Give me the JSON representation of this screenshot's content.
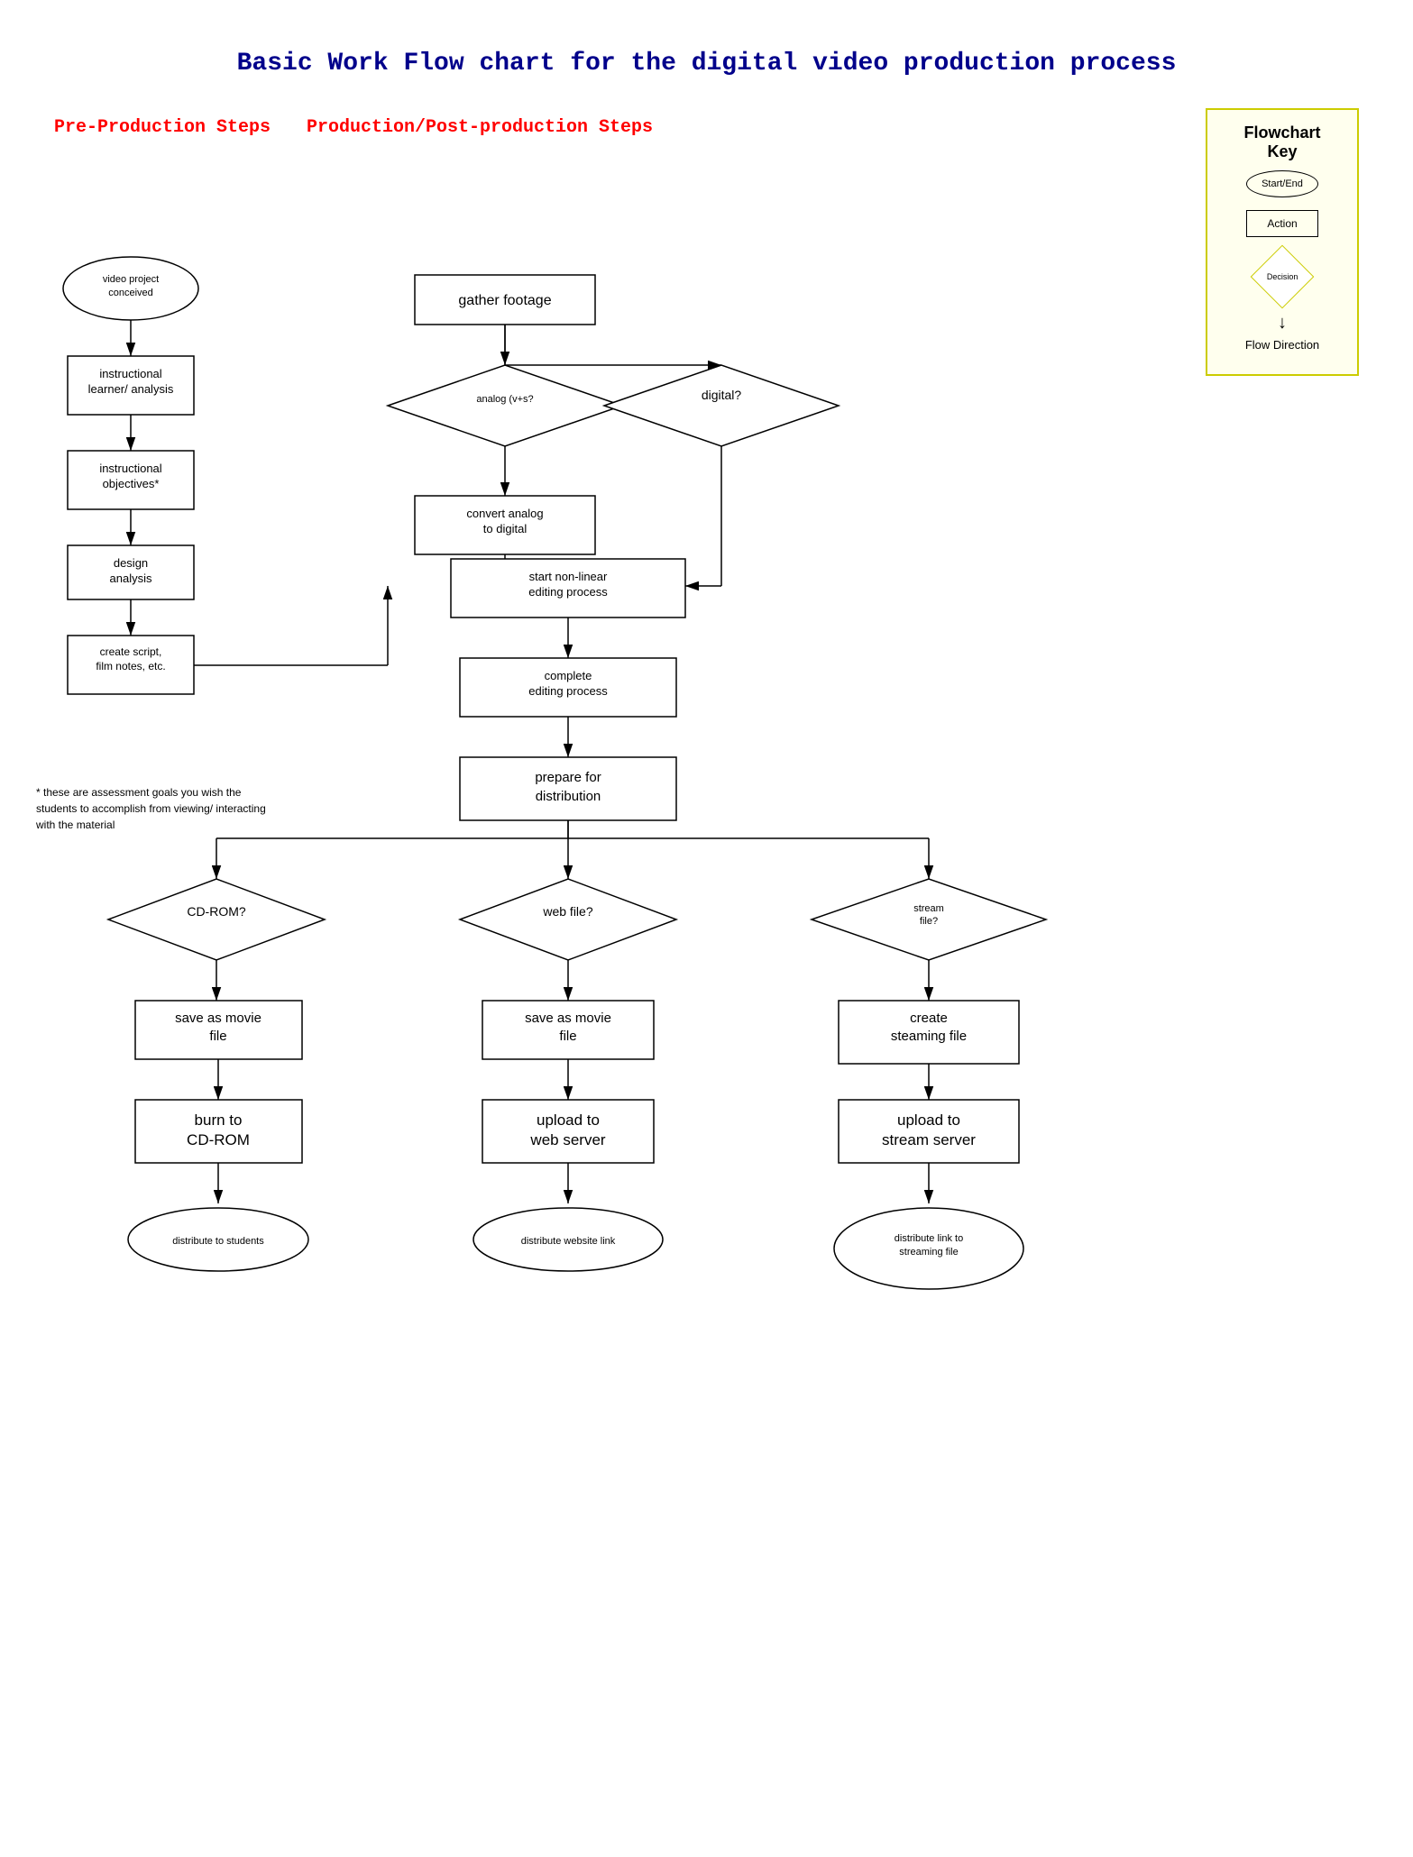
{
  "title": "Basic Work Flow chart for the digital video production process",
  "sections": {
    "pre_production": "Pre-Production Steps",
    "production": "Production/Post-production Steps"
  },
  "key": {
    "title": "Flowchart Key",
    "start_end": "Start/End",
    "action": "Action",
    "decision": "Decision",
    "flow_direction": "Flow Direction"
  },
  "nodes": {
    "video_project": "video project\nconceived",
    "instructional_learner": "instructional\nlearner/ analysis",
    "instructional_objectives": "instructional\nobjectives*",
    "design_analysis": "design\nanalysis",
    "create_script": "create script,\nfilm notes, etc.",
    "gather_footage": "gather footage",
    "analog": "analog (v+s?",
    "digital": "digital?",
    "convert_analog": "convert analog\nto digital",
    "start_nonlinear": "start non-linear\nediting process",
    "complete_editing": "complete\nediting process",
    "prepare_distribution": "prepare for\ndistribution",
    "cdrom_q": "CD-ROM?",
    "web_q": "web file?",
    "stream_q": "stream\nfile?",
    "save_movie_cdrom": "save as movie\nfile",
    "save_movie_web": "save as movie\nfile",
    "create_streaming": "create\nsteaming file",
    "burn_cdrom": "burn to\nCD-ROM",
    "upload_web": "upload to\nweb server",
    "upload_stream": "upload to\nstream server",
    "distribute_students": "distribute to students",
    "distribute_web": "distribute website link",
    "distribute_streaming": "distribute link to\nstreaming file"
  },
  "footnote": "* these are assessment goals you wish the students to accomplish from viewing/ interacting with the material"
}
